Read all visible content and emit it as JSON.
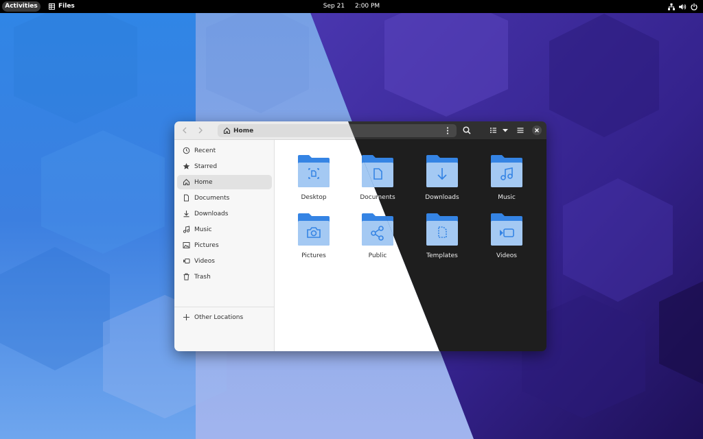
{
  "topbar": {
    "activities_label": "Activities",
    "app_name": "Files",
    "date": "Sep 21",
    "time": "2:00 PM"
  },
  "window": {
    "location": "Home",
    "sidebar": {
      "items": [
        {
          "label": "Recent",
          "icon": "clock-icon"
        },
        {
          "label": "Starred",
          "icon": "star-icon"
        },
        {
          "label": "Home",
          "icon": "home-icon",
          "active": true
        },
        {
          "label": "Documents",
          "icon": "document-icon"
        },
        {
          "label": "Downloads",
          "icon": "download-icon"
        },
        {
          "label": "Music",
          "icon": "music-icon"
        },
        {
          "label": "Pictures",
          "icon": "picture-icon"
        },
        {
          "label": "Videos",
          "icon": "video-icon"
        },
        {
          "label": "Trash",
          "icon": "trash-icon"
        }
      ],
      "other_locations": {
        "label": "Other Locations",
        "icon": "plus-icon"
      }
    },
    "folders": [
      {
        "label": "Desktop",
        "icon": "desktop-folder-icon"
      },
      {
        "label": "Documents",
        "icon": "documents-folder-icon"
      },
      {
        "label": "Downloads",
        "icon": "downloads-folder-icon"
      },
      {
        "label": "Music",
        "icon": "music-folder-icon"
      },
      {
        "label": "Pictures",
        "icon": "pictures-folder-icon"
      },
      {
        "label": "Public",
        "icon": "public-folder-icon"
      },
      {
        "label": "Templates",
        "icon": "templates-folder-icon"
      },
      {
        "label": "Videos",
        "icon": "videos-folder-icon"
      }
    ]
  },
  "colors": {
    "folder_back": "#3584e4",
    "folder_front": "#a4c9f3",
    "folder_glyph": "#3584e4",
    "wallpaper_blue": "#3a8fe8",
    "wallpaper_purple": "#3d2a9a"
  }
}
